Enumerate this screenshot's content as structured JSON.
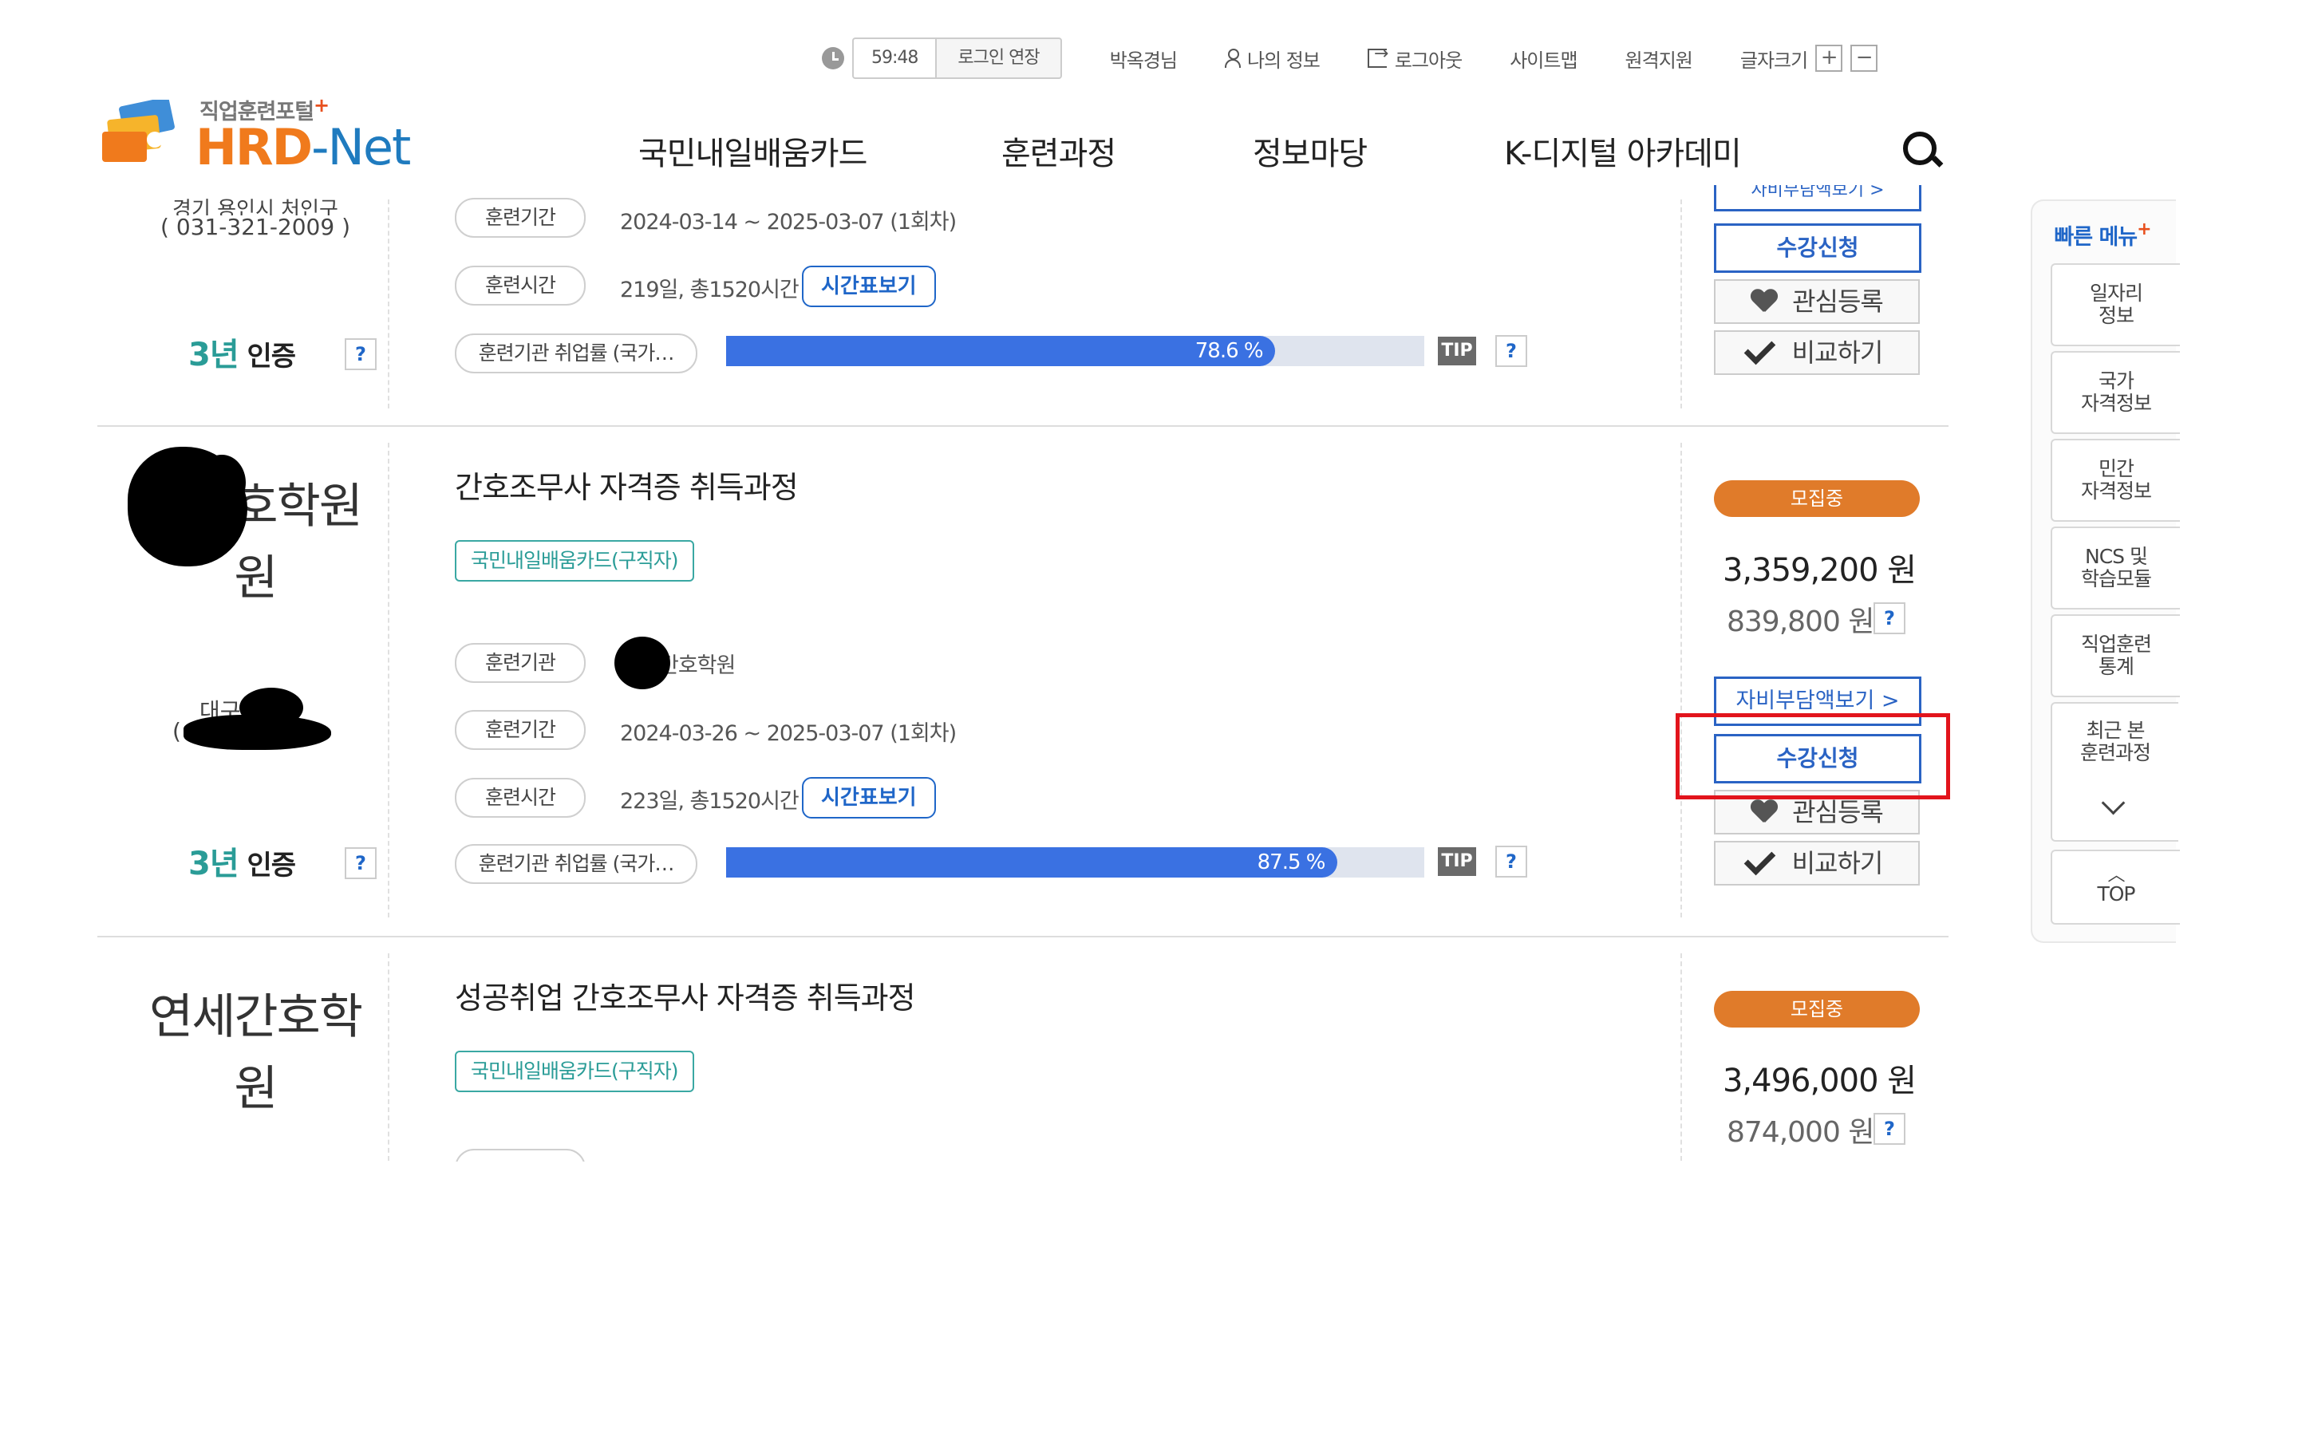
{
  "util": {
    "timer": "59:48",
    "extend": "로그인 연장",
    "user": "박옥경님",
    "myinfo": "나의 정보",
    "logout": "로그아웃",
    "sitemap": "사이트맵",
    "remote": "원격지원",
    "fontsize": "글자크기",
    "plus": "+",
    "minus": "−"
  },
  "logo": {
    "sub": "직업훈련포털",
    "plus": "+",
    "main_a": "HRD",
    "main_b": "-",
    "main_c": "Net"
  },
  "nav": [
    "국민내일배움카드",
    "훈련과정",
    "정보마당",
    "K-디지털 아카데미"
  ],
  "quick": {
    "title": "빠른 메뉴",
    "plus": "+",
    "items": [
      "일자리\n정보",
      "국가\n자격정보",
      "민간\n자격정보",
      "NCS 및\n학습모듈",
      "직업훈련\n통계",
      "최근 본\n훈련과정"
    ],
    "top": "TOP"
  },
  "courses": [
    {
      "inst_addr": "경기 용인시 처인구",
      "inst_phone": "( 031-321-2009 )",
      "cert": "인증",
      "cert_n": "3년",
      "period_label": "훈련기간",
      "period": "2024-03-14 ~ 2025-03-07 (1회차)",
      "hours_label": "훈련시간",
      "hours": "219일, 총1520시간",
      "timetable": "시간표보기",
      "emp_label": "훈련기관 취업률 (국가…",
      "emp_rate": 78.6,
      "emp_text": "78.6 %",
      "tip": "TIP",
      "q": "?",
      "apply": "수강신청",
      "like": "관심등록",
      "compare": "비교하기",
      "partial": "자비부담액보기 >"
    },
    {
      "inst_name": "간호학원",
      "inst_addr": "대구",
      "inst_addr2": "(",
      "cert": "인증",
      "cert_n": "3년",
      "title": "간호조무사 자격증 취득과정",
      "tag": "국민내일배움카드(구직자)",
      "org_label": "훈련기관",
      "org": "간호학원",
      "period_label": "훈련기간",
      "period": "2024-03-26 ~ 2025-03-07 (1회차)",
      "hours_label": "훈련시간",
      "hours": "223일, 총1520시간",
      "timetable": "시간표보기",
      "emp_label": "훈련기관 취업률 (국가…",
      "emp_rate": 87.5,
      "emp_text": "87.5 %",
      "tip": "TIP",
      "q": "?",
      "recruit": "모집중",
      "price": "3,359,200 원",
      "self_price": "839,800 원",
      "self_btn": "자비부담액보기 >",
      "apply": "수강신청",
      "like": "관심등록",
      "compare": "비교하기"
    },
    {
      "inst_name_1": "연세간호학",
      "inst_name_2": "원",
      "title": "성공취업 간호조무사 자격증 취득과정",
      "tag": "국민내일배움카드(구직자)",
      "recruit": "모집중",
      "price": "3,496,000 원",
      "self_price": "874,000 원",
      "q": "?"
    }
  ]
}
